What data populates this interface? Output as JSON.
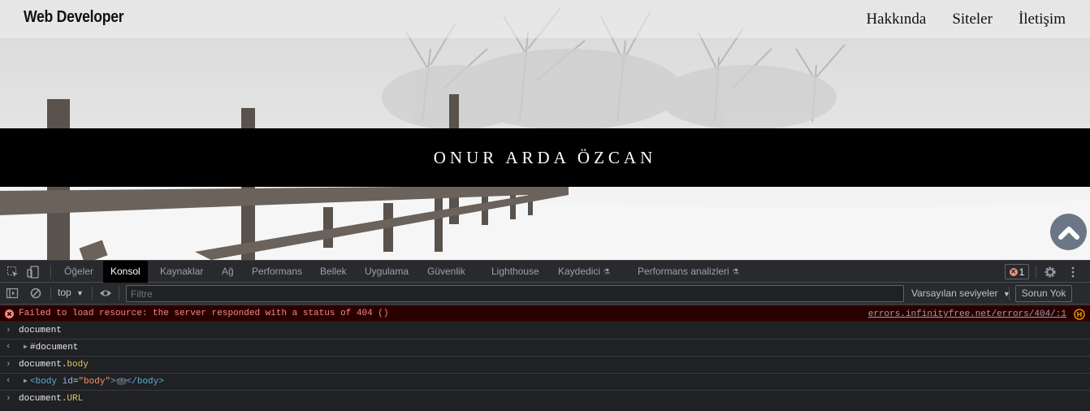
{
  "site": {
    "brand": "Web Developer",
    "nav": [
      "Hakkında",
      "Siteler",
      "İletişim"
    ],
    "banner_title": "ONUR ARDA ÖZCAN",
    "scroll_top_icon": "chevron-up-icon"
  },
  "devtools": {
    "tabs": [
      "Öğeler",
      "Konsol",
      "Kaynaklar",
      "Ağ",
      "Performans",
      "Bellek",
      "Uygulama",
      "Güvenlik",
      "Lighthouse",
      "Kaydedici",
      "Performans analizleri"
    ],
    "active_tab": "Konsol",
    "error_count": "1",
    "context": "top",
    "filter_placeholder": "Filtre",
    "levels": "Varsayılan seviyeler",
    "issues": "Sorun Yok",
    "error_message": "Failed to load resource: the server responded with a status of 404 ()",
    "error_source": "errors.infinityfree.net/errors/404/:1",
    "entries": [
      {
        "type": "input",
        "text": "document"
      },
      {
        "type": "output",
        "text": "#document"
      },
      {
        "type": "input",
        "obj": "document",
        "prop": "body"
      },
      {
        "type": "output",
        "tag_open": "<body",
        "attr": "id",
        "value": "\"body\"",
        "tag_close": "</body>"
      },
      {
        "type": "input",
        "obj": "document",
        "prop": "URL"
      }
    ]
  },
  "colors": {
    "devtools_bg": "#202124",
    "error_bg": "#290000",
    "error_text": "#f28b82",
    "banner_bg": "#000000"
  }
}
